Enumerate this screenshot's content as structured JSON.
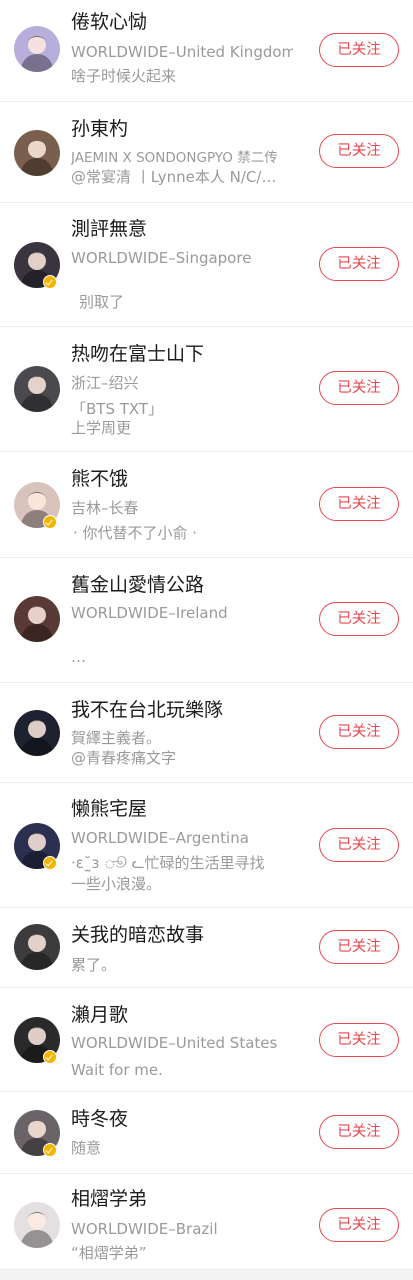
{
  "follow_label": "已关注",
  "users": [
    {
      "name": "倦软心恸",
      "lines": [
        "WORLDWIDE–United Kingdom",
        "啥子时候火起来"
      ],
      "verified": false,
      "avatar_color": "#b8aedb"
    },
    {
      "name": "孙東杓",
      "lines": [
        "JAEMIN X SONDONGPYO 禁二传",
        "@常宴清 丨Lynne本人 N/C/…"
      ],
      "verified": false,
      "avatar_color": "#7a5f4e"
    },
    {
      "name": "測評無意",
      "lines": [
        "WORLDWIDE–Singapore",
        "",
        "别取了"
      ],
      "verified": true,
      "avatar_color": "#3a3440"
    },
    {
      "name": "热吻在富士山下",
      "lines": [
        "浙江–绍兴",
        "「BTS TXT」",
        "上学周更"
      ],
      "verified": false,
      "avatar_color": "#4a4a4e"
    },
    {
      "name": "熊不饿",
      "lines": [
        "吉林–长春",
        "· 你代替不了小俞 ·"
      ],
      "verified": true,
      "avatar_color": "#d9c3bd"
    },
    {
      "name": "舊金山愛情公路",
      "lines": [
        "WORLDWIDE–Ireland",
        "",
        "…"
      ],
      "verified": false,
      "avatar_color": "#5a3a36"
    },
    {
      "name": "我不在台北玩樂隊",
      "lines": [
        "賀繹主義者。",
        "@青春疼痛文字"
      ],
      "verified": false,
      "avatar_color": "#1e2230"
    },
    {
      "name": "懒熊宅屋",
      "lines": [
        "WORLDWIDE–Argentina",
        "·ɛ˘̫ɜ ூ ᓚ忙碌的生活里寻找",
        "一些小浪漫。"
      ],
      "verified": true,
      "avatar_color": "#2c3050"
    },
    {
      "name": "关我的暗恋故事",
      "lines": [
        "累了。"
      ],
      "verified": false,
      "avatar_color": "#3c3c3e"
    },
    {
      "name": "瀨月歌",
      "lines": [
        "WORLDWIDE–United States",
        "Wait for me."
      ],
      "verified": true,
      "avatar_color": "#2a2a2c"
    },
    {
      "name": "時冬夜",
      "lines": [
        "随意"
      ],
      "verified": true,
      "avatar_color": "#6a6468"
    },
    {
      "name": "相熠学弟",
      "lines": [
        "WORLDWIDE–Brazil",
        "“相熠学弟”"
      ],
      "verified": false,
      "avatar_color": "#e4e0e2"
    }
  ]
}
